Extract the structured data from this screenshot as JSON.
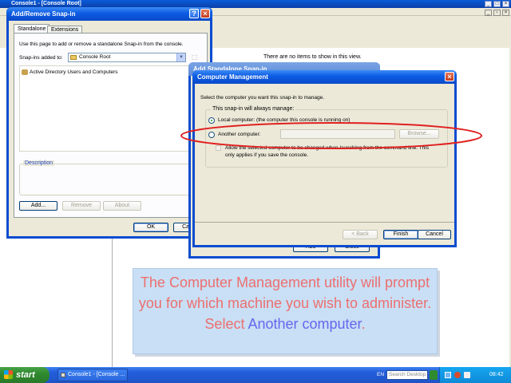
{
  "console": {
    "title": "Console1 - [Console Root]",
    "content_empty_message": "There are no items to show in this view."
  },
  "add_remove": {
    "title": "Add/Remove Snap-in",
    "tabs": [
      "Standalone",
      "Extensions"
    ],
    "instruction": "Use this page to add or remove a standalone Snap-in from the console.",
    "snapins_added_to_label": "Snap-ins added to:",
    "snapins_added_to_value": "Console Root",
    "snapin_items": [
      "Active Directory Users and Computers"
    ],
    "description_label": "Description",
    "buttons": {
      "add": "Add...",
      "remove": "Remove",
      "about": "About",
      "ok": "OK",
      "cancel": "Cancel"
    }
  },
  "add_standalone": {
    "title": "Add Standalone Snap-in",
    "buttons": {
      "add": "Add",
      "close": "Close"
    }
  },
  "computer_mgmt": {
    "title": "Computer Management",
    "instruction": "Select the computer you want this snap-in to manage.",
    "group_label": "This snap-in will always manage:",
    "radio_local": "Local computer:  (the computer this console is running on)",
    "radio_another": "Another computer:",
    "browse_label": "Browse...",
    "checkbox_text_line1": "Allow the selected computer to be changed when launching from the command line. This",
    "checkbox_text_line2": "only applies if you save the console.",
    "buttons": {
      "back": "< Back",
      "finish": "Finish",
      "cancel": "Cancel"
    }
  },
  "caption": {
    "part1": "The Computer Management utility will prompt you for which machine you wish to administer. Select",
    "highlight": "Another computer",
    "part2": "."
  },
  "taskbar": {
    "start_label": "start",
    "task_label": "Console1 - [Console ...",
    "lang": "EN",
    "search_placeholder": "Search Desktop",
    "clock": "08:42"
  },
  "colors": {
    "xp_blue": "#0a4cd0",
    "highlight_ellipse": "#e02020",
    "caption_text": "#ec6f6f",
    "caption_highlight": "#6666ee",
    "caption_bg": "#c9dff5"
  }
}
